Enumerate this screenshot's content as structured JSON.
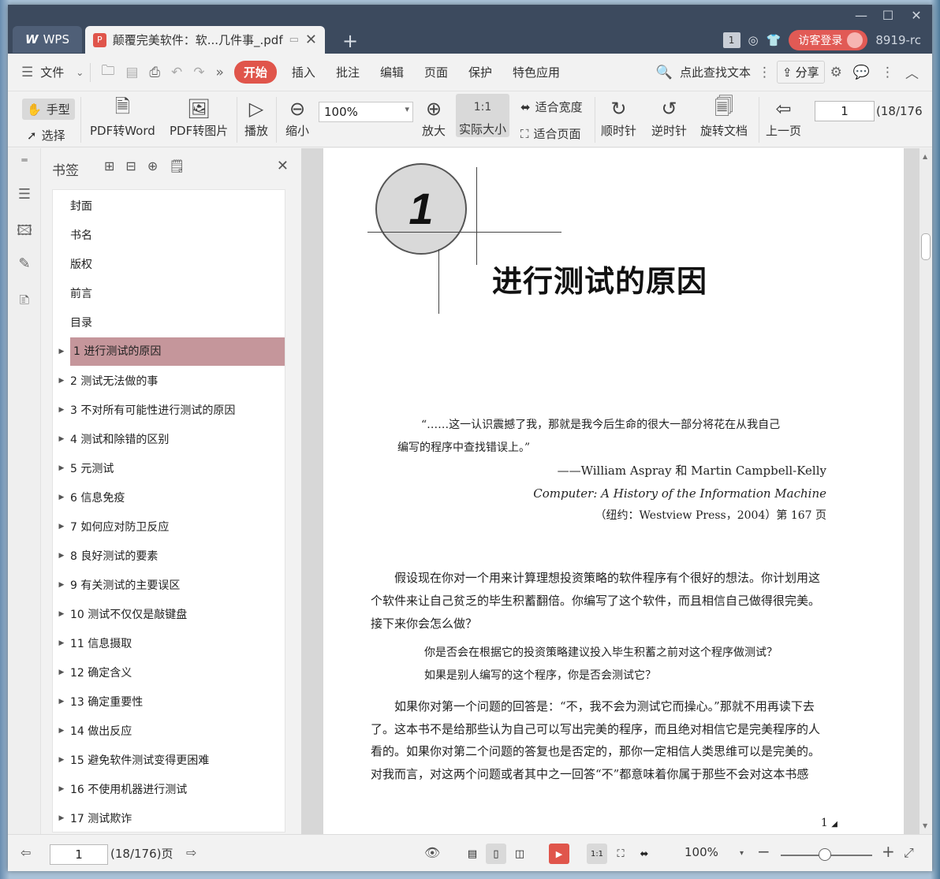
{
  "window": {
    "min_label": "—",
    "max_label": "☐",
    "close_label": "✕"
  },
  "tabs": [
    {
      "label": "WPS"
    },
    {
      "label": "颠覆完美软件：软...几件事_.pdf"
    }
  ],
  "titlebar": {
    "new_tab": "+",
    "page_badge": "1",
    "login_label": "访客登录",
    "version": "8919-rc"
  },
  "menu": {
    "file_label": "文件",
    "items": [
      "开始",
      "插入",
      "批注",
      "编辑",
      "页面",
      "保护",
      "特色应用"
    ],
    "active_index": 0,
    "search_label": "点此查找文本",
    "share_label": "分享"
  },
  "ribbon": {
    "hand_label": "手型",
    "select_label": "选择",
    "pdf2word_label": "PDF转Word",
    "pdf2img_label": "PDF转图片",
    "play_label": "播放",
    "zoomout_label": "缩小",
    "zoom_value": "100%",
    "zoomin_label": "放大",
    "actual_label": "实际大小",
    "fitwidth_label": "适合宽度",
    "fitpage_label": "适合页面",
    "cw_label": "顺时针",
    "ccw_label": "逆时针",
    "rotate_label": "旋转文档",
    "prev_label": "上一页",
    "page_value": "1",
    "page_total": "(18/176"
  },
  "bookmarks": {
    "title": "书签",
    "items": [
      {
        "label": "封面",
        "expand": false
      },
      {
        "label": "书名",
        "expand": false
      },
      {
        "label": "版权",
        "expand": false
      },
      {
        "label": "前言",
        "expand": false
      },
      {
        "label": "目录",
        "expand": false
      },
      {
        "label": "1  进行测试的原因",
        "expand": true
      },
      {
        "label": "2  测试无法做的事",
        "expand": true
      },
      {
        "label": "3  不对所有可能性进行测试的原因",
        "expand": true
      },
      {
        "label": "4  测试和除错的区别",
        "expand": true
      },
      {
        "label": "5  元测试",
        "expand": true
      },
      {
        "label": "6  信息免疫",
        "expand": true
      },
      {
        "label": "7  如何应对防卫反应",
        "expand": true
      },
      {
        "label": "8  良好测试的要素",
        "expand": true
      },
      {
        "label": "9  有关测试的主要误区",
        "expand": true
      },
      {
        "label": "10  测试不仅仅是敲键盘",
        "expand": true
      },
      {
        "label": "11  信息摄取",
        "expand": true
      },
      {
        "label": "12  确定含义",
        "expand": true
      },
      {
        "label": "13  确定重要性",
        "expand": true
      },
      {
        "label": "14  做出反应",
        "expand": true
      },
      {
        "label": "15  避免软件测试变得更困难",
        "expand": true
      },
      {
        "label": "16  不使用机器进行测试",
        "expand": true
      },
      {
        "label": "17  测试欺诈",
        "expand": true
      }
    ],
    "selected_index": 5
  },
  "page": {
    "chapter_number": "1",
    "chapter_title": "进行测试的原因",
    "quote_line1": "“……这一认识震撼了我，那就是我今后生命的很大一部分将花在从我自己",
    "quote_line2": "编写的程序中查找错误上。”",
    "quote_author": "——William Aspray 和 Martin Campbell-Kelly",
    "quote_book": "Computer: A History of the Information Machine",
    "quote_pub": "（纽约：Westview Press，2004）第 167 页",
    "para1_line1": "假设现在你对一个用来计算理想投资策略的软件程序有个很好的想法。你计划用这",
    "para1_line2": "个软件来让自己贫乏的毕生积蓄翻倍。你编写了这个软件，而且相信自己做得很完美。",
    "para1_line3": "接下来你会怎么做？",
    "q1": "你是否会在根据它的投资策略建议投入毕生积蓄之前对这个程序做测试？",
    "q2": "如果是别人编写的这个程序，你是否会测试它？",
    "para2_line1": "如果你对第一个问题的回答是：“不，我不会为测试它而操心。”那就不用再读下去",
    "para2_line2": "了。这本书不是给那些认为自己可以写出完美的程序，而且绝对相信它是完美程序的人",
    "para2_line3": "看的。如果你对第二个问题的答复也是否定的，那你一定相信人类思维可以是完美的。",
    "para2_line4": "对我而言，对这两个问题或者其中之一回答“不”都意味着你属于那些不会对这本书感",
    "page_number": "1"
  },
  "statusbar": {
    "page_value": "1",
    "page_total": "(18/176)页",
    "zoom_value": "100%"
  },
  "colors": {
    "accent": "#e0554b",
    "selected_bookmark": "#c5969b",
    "titlebar": "#3c4a5e"
  }
}
